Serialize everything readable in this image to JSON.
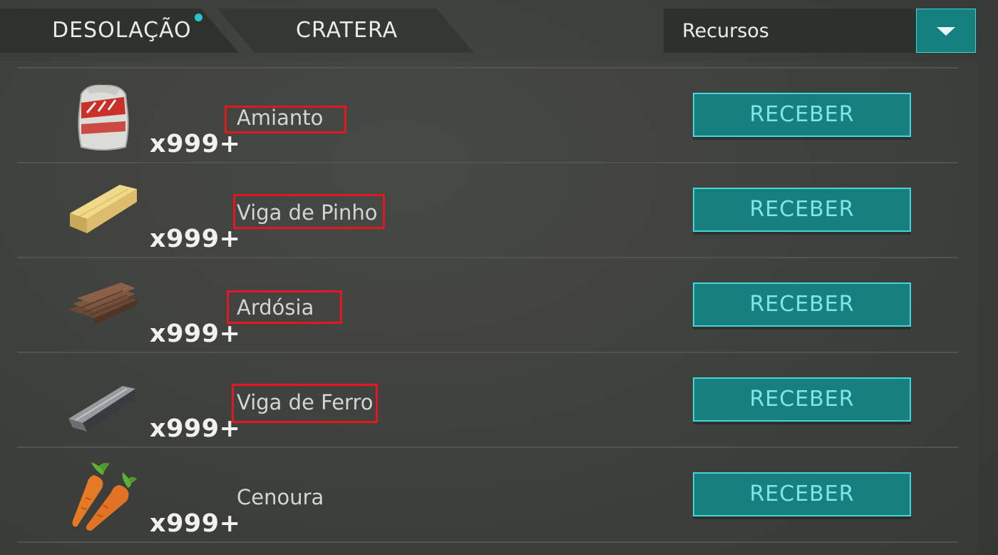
{
  "tabs": [
    {
      "label": "DESOLAÇÃO",
      "active": true,
      "has_notification": true
    },
    {
      "label": "CRATERA",
      "active": false
    }
  ],
  "filter": {
    "selected": "Recursos"
  },
  "colors": {
    "accent": "#17807f",
    "accent_border": "#43d5d8",
    "button_text": "#7de6e8",
    "notification_dot": "#27c6cf",
    "highlight": "#e4161e",
    "background": "#3a3c39"
  },
  "items": [
    {
      "name": "Amianto",
      "qty": "x999+",
      "icon": "asbestos-bag-icon",
      "button": "RECEBER",
      "highlighted": true
    },
    {
      "name": "Viga de Pinho",
      "qty": "x999+",
      "icon": "pine-beam-icon",
      "button": "RECEBER",
      "highlighted": true
    },
    {
      "name": "Ardósia",
      "qty": "x999+",
      "icon": "slate-icon",
      "button": "RECEBER",
      "highlighted": true
    },
    {
      "name": "Viga de Ferro",
      "qty": "x999+",
      "icon": "iron-beam-icon",
      "button": "RECEBER",
      "highlighted": true
    },
    {
      "name": "Cenoura",
      "qty": "x999+",
      "icon": "carrot-icon",
      "button": "RECEBER",
      "highlighted": false
    }
  ]
}
